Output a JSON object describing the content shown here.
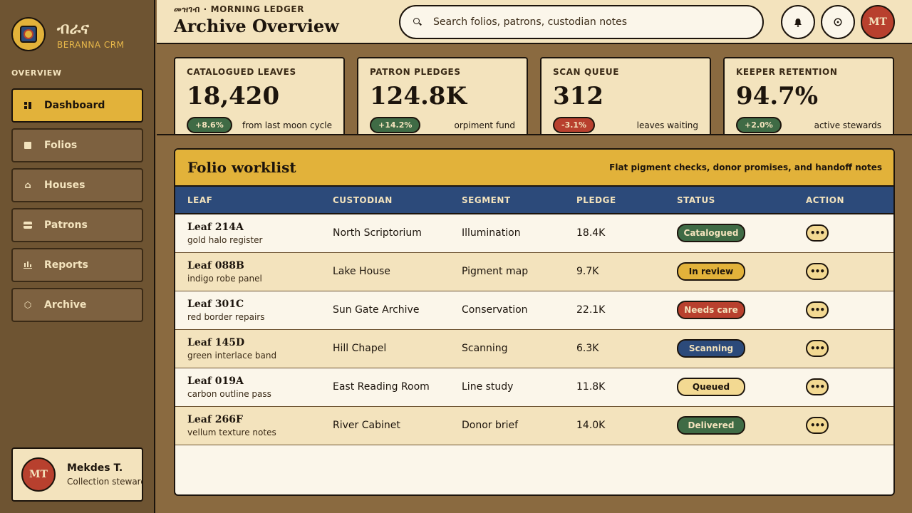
{
  "brand": {
    "name": "ብራና",
    "sub": "BERANNA CRM"
  },
  "sidebar": {
    "section_label": "OVERVIEW",
    "items": [
      {
        "label": "Dashboard",
        "icon": "dashboard-icon",
        "active": true
      },
      {
        "label": "Folios",
        "icon": "folio-icon"
      },
      {
        "label": "Houses",
        "icon": "house-icon"
      },
      {
        "label": "Patrons",
        "icon": "patrons-icon"
      },
      {
        "label": "Reports",
        "icon": "reports-icon"
      },
      {
        "label": "Archive",
        "icon": "archive-icon"
      }
    ],
    "user": {
      "initials": "MT",
      "name": "Mekdes T.",
      "role": "Collection steward"
    }
  },
  "header": {
    "eyebrow": "መዝገብ · MORNING LEDGER",
    "title": "Archive Overview",
    "search_placeholder": "Search folios, patrons, custodian notes",
    "avatar_initials": "MT"
  },
  "stats": [
    {
      "label": "CATALOGUED LEAVES",
      "value": "18,420",
      "delta": "+8.6%",
      "note": "from last moon cycle",
      "tone": "green"
    },
    {
      "label": "PATRON PLEDGES",
      "value": "124.8K",
      "delta": "+14.2%",
      "note": "orpiment fund",
      "tone": "green"
    },
    {
      "label": "SCAN QUEUE",
      "value": "312",
      "delta": "-3.1%",
      "note": "leaves waiting",
      "tone": "red"
    },
    {
      "label": "KEEPER RETENTION",
      "value": "94.7%",
      "delta": "+2.0%",
      "note": "active stewards",
      "tone": "green"
    }
  ],
  "worklist": {
    "title": "Folio worklist",
    "subtitle": "Flat pigment checks, donor promises, and handoff notes",
    "columns": [
      "LEAF",
      "CUSTODIAN",
      "SEGMENT",
      "PLEDGE",
      "STATUS",
      "ACTION"
    ],
    "rows": [
      {
        "leaf": "Leaf 214A",
        "desc": "gold halo register",
        "custodian": "North Scriptorium",
        "segment": "Illumination",
        "pledge": "18.4K",
        "status": "Catalogued"
      },
      {
        "leaf": "Leaf 088B",
        "desc": "indigo robe panel",
        "custodian": "Lake House",
        "segment": "Pigment map",
        "pledge": "9.7K",
        "status": "In review"
      },
      {
        "leaf": "Leaf 301C",
        "desc": "red border repairs",
        "custodian": "Sun Gate Archive",
        "segment": "Conservation",
        "pledge": "22.1K",
        "status": "Needs care"
      },
      {
        "leaf": "Leaf 145D",
        "desc": "green interlace band",
        "custodian": "Hill Chapel",
        "segment": "Scanning",
        "pledge": "6.3K",
        "status": "Scanning"
      },
      {
        "leaf": "Leaf 019A",
        "desc": "carbon outline pass",
        "custodian": "East Reading Room",
        "segment": "Line study",
        "pledge": "11.8K",
        "status": "Queued"
      },
      {
        "leaf": "Leaf 266F",
        "desc": "vellum texture notes",
        "custodian": "River Cabinet",
        "segment": "Donor brief",
        "pledge": "14.0K",
        "status": "Delivered"
      }
    ],
    "action_label": "•••"
  },
  "colors": {
    "status": {
      "Catalogued": {
        "bg": "#3f6b45",
        "fg": "#f3e3bd"
      },
      "In review": {
        "bg": "#e2b23a",
        "fg": "#1c140c"
      },
      "Needs care": {
        "bg": "#b8402e",
        "fg": "#f3e3bd"
      },
      "Scanning": {
        "bg": "#2c4a7a",
        "fg": "#f3e3bd"
      },
      "Queued": {
        "bg": "#f3d992",
        "fg": "#1c140c"
      },
      "Delivered": {
        "bg": "#3f6b45",
        "fg": "#f3e3bd"
      }
    }
  }
}
